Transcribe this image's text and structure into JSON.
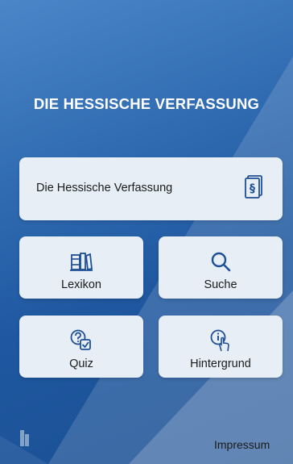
{
  "header": {
    "title": "DIE HESSISCHE VERFASSUNG"
  },
  "main_card": {
    "label": "Die Hessische Verfassung",
    "icon": "paragraph-document-icon"
  },
  "tiles": [
    {
      "label": "Lexikon",
      "icon": "books-icon"
    },
    {
      "label": "Suche",
      "icon": "search-icon"
    },
    {
      "label": "Quiz",
      "icon": "quiz-question-icon"
    },
    {
      "label": "Hintergrund",
      "icon": "info-hand-icon"
    }
  ],
  "footer": {
    "impressum_label": "Impressum",
    "logo_icon": "logo-icon"
  },
  "colors": {
    "background": "#2f6ab0",
    "card": "#e7eef6",
    "icon": "#1f4f95",
    "text": "#1b1b1b"
  }
}
